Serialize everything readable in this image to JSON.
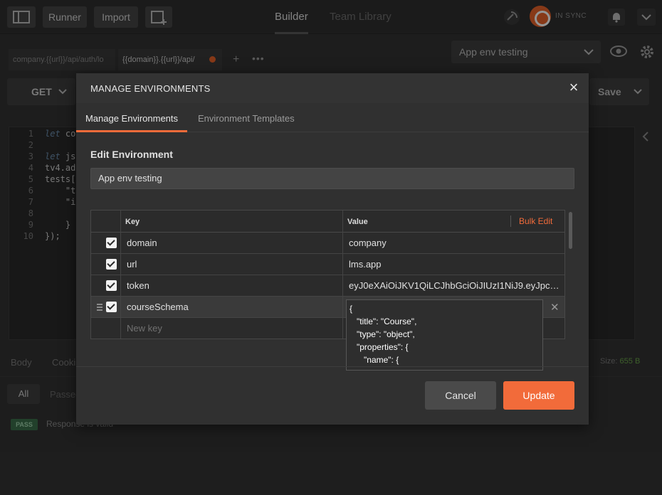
{
  "app": {
    "runner_label": "Runner",
    "import_label": "Import",
    "tabs": [
      {
        "label": "Builder",
        "active": true
      },
      {
        "label": "Team Library",
        "active": false
      }
    ],
    "sync_label": "IN SYNC",
    "request_tabs": [
      {
        "label": "company.{{url}}/api/auth/lo"
      },
      {
        "label": "{{domain}}.{{url}}/api/"
      }
    ],
    "environment_select": "App env testing",
    "method": "GET",
    "save_label": "Save",
    "code_lines": [
      {
        "n": "1",
        "kw": "let",
        "text": " co"
      },
      {
        "n": "2",
        "kw": "",
        "text": ""
      },
      {
        "n": "3",
        "kw": "let",
        "text": " js"
      },
      {
        "n": "4",
        "kw": "",
        "text": "tv4.ad"
      },
      {
        "n": "5",
        "kw": "",
        "text": "tests["
      },
      {
        "n": "6",
        "kw": "",
        "text": "    \"t"
      },
      {
        "n": "7",
        "kw": "",
        "text": "    \"i"
      },
      {
        "n": "8",
        "kw": "",
        "text": ""
      },
      {
        "n": "9",
        "kw": "",
        "text": "    }"
      },
      {
        "n": "10",
        "kw": "",
        "text": "});"
      }
    ],
    "response_tabs": [
      "Body",
      "Cooki"
    ],
    "size_label": "Size:",
    "size_value": "655 B",
    "filter_all": "All",
    "filter_passed": "Passed",
    "test_badge": "PASS",
    "test_text": "Response is valid"
  },
  "modal": {
    "title": "MANAGE ENVIRONMENTS",
    "tabs": [
      {
        "label": "Manage Environments",
        "active": true
      },
      {
        "label": "Environment Templates",
        "active": false
      }
    ],
    "section_title": "Edit Environment",
    "environment_name": "App env testing",
    "table": {
      "key_header": "Key",
      "value_header": "Value",
      "bulk_edit": "Bulk Edit",
      "rows": [
        {
          "key": "domain",
          "value": "company",
          "enabled": true
        },
        {
          "key": "url",
          "value": "lms.app",
          "enabled": true
        },
        {
          "key": "token",
          "value": "eyJ0eXAiOiJKV1QiLCJhbGciOiJIUzI1NiJ9.eyJpc3MiOiJ...",
          "enabled": true
        },
        {
          "key": "courseSchema",
          "value": "",
          "enabled": true
        }
      ],
      "new_key_placeholder": "New key",
      "expanded_value_lines": [
        "{",
        "   \"title\": \"Course\",",
        "   \"type\": \"object\",",
        "   \"properties\": {",
        "      \"name\": {"
      ]
    },
    "cancel_label": "Cancel",
    "update_label": "Update"
  },
  "colors": {
    "accent": "#f26b3a",
    "background": "#333333",
    "modal": "#303030"
  }
}
